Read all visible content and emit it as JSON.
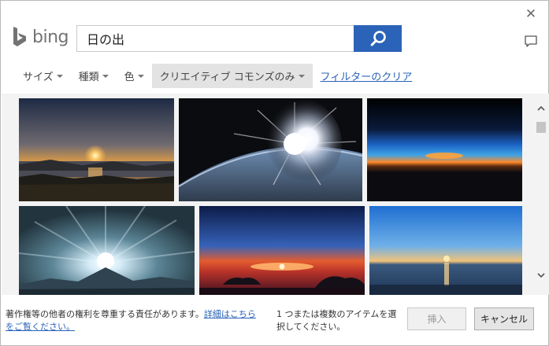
{
  "dialog": {
    "close_icon_glyph": "✕"
  },
  "brand": {
    "name": "bing",
    "color": "#737373"
  },
  "search": {
    "query": "日の出",
    "button_icon": "search-icon",
    "accent": "#2b63b8"
  },
  "filters": {
    "items": [
      {
        "label": "サイズ",
        "active": false
      },
      {
        "label": "種類",
        "active": false
      },
      {
        "label": "色",
        "active": false
      },
      {
        "label": "クリエイティブ コモンズのみ",
        "active": true
      }
    ],
    "clear_label": "フィルターのクリア"
  },
  "results": {
    "images": [
      {
        "subject": "sunrise over lake with islands"
      },
      {
        "subject": "sunrise over earth from space"
      },
      {
        "subject": "orange horizon line at dusk"
      },
      {
        "subject": "sun rays behind mountain peak"
      },
      {
        "subject": "red sunrise with clouds"
      },
      {
        "subject": "sunrise over calm sea"
      }
    ]
  },
  "footer": {
    "notice_text": "著作権等の他者の権利を尊重する責任があります。",
    "notice_link": "詳細はこちらをご覧ください。",
    "status": "1 つまたは複数のアイテムを選択してください。",
    "insert_label": "挿入",
    "cancel_label": "キャンセル"
  }
}
